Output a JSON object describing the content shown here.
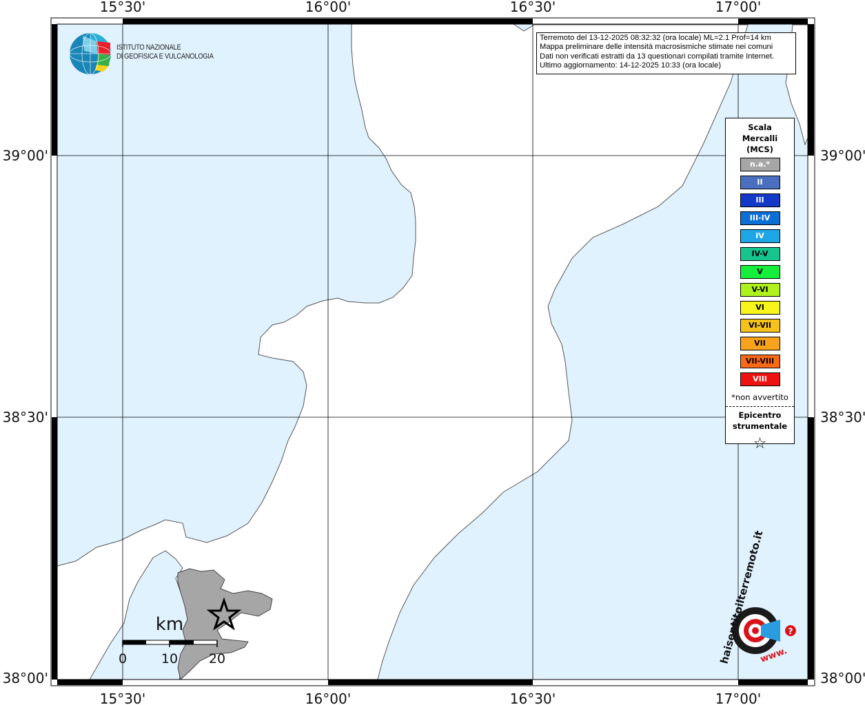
{
  "header": {
    "info_lines": [
      "Terremoto del 13-12-2025 08:32:32 (ora locale) ML=2.1 Prof=14 km",
      "Mappa preliminare delle intensità macrosismiche stimate nei comuni",
      "Dati non verificati estratti da 13 questionari compilati tramite Internet.",
      "Ultimo aggiornamento: 14-12-2025 10:33 (ora locale)"
    ]
  },
  "logo": {
    "line1": "ISTITUTO NAZIONALE",
    "line2": "DI GEOFISICA E VULCANOLOGIA"
  },
  "axes": {
    "lon_labels": [
      "15°30'",
      "16°00'",
      "16°30'",
      "17°00'"
    ],
    "lat_labels": [
      "39°00'",
      "38°30'",
      "38°00'"
    ]
  },
  "scale_bar": {
    "unit": "km",
    "ticks": [
      "0",
      "10",
      "20"
    ]
  },
  "legend": {
    "title_lines": [
      "Scala",
      "Mercalli",
      "(MCS)"
    ],
    "items": [
      {
        "label": "n.a.*",
        "color": "#a6a6a6",
        "text_color": "#ffffff"
      },
      {
        "label": "II",
        "color": "#4a6fbf",
        "text_color": "#ffffff"
      },
      {
        "label": "III",
        "color": "#1239c8",
        "text_color": "#ffffff"
      },
      {
        "label": "III-IV",
        "color": "#0b6fd6",
        "text_color": "#ffffff"
      },
      {
        "label": "IV",
        "color": "#1ea6e6",
        "text_color": "#ffffff"
      },
      {
        "label": "IV-V",
        "color": "#16c58e",
        "text_color": "#000000"
      },
      {
        "label": "V",
        "color": "#15ee3a",
        "text_color": "#000000"
      },
      {
        "label": "V-VI",
        "color": "#aef21c",
        "text_color": "#000000"
      },
      {
        "label": "VI",
        "color": "#f8f51a",
        "text_color": "#000000"
      },
      {
        "label": "VI-VII",
        "color": "#f5c21b",
        "text_color": "#000000"
      },
      {
        "label": "VII",
        "color": "#f9a21c",
        "text_color": "#000000"
      },
      {
        "label": "VII-VIII",
        "color": "#fa6a14",
        "text_color": "#000000"
      },
      {
        "label": "VIII",
        "color": "#ee1111",
        "text_color": "#ffffff"
      }
    ],
    "note": "*non avvertito",
    "epicenter_lines": [
      "Epicentro",
      "strumentale"
    ],
    "epicenter_symbol": "☆"
  },
  "watermark": {
    "text_main": "haisentitoilterremoto.it",
    "text_www": "www.",
    "question": "?"
  },
  "colors": {
    "sea": "#e0f2fd",
    "land": "#ffffff",
    "inset_land": "#a6a6a6",
    "grid": "#000000"
  }
}
